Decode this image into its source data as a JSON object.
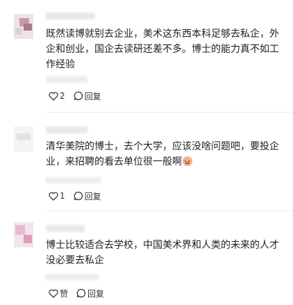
{
  "comments": [
    {
      "text": "既然读博就别去企业，美术这东西本科足够去私企，外企和创业，国企去读研还差不多。博士的能力真不如工作经验",
      "like_count": "2",
      "reply_label": "回复"
    },
    {
      "text": "清华美院的博士，去个大学，应该没啥问题吧，要投企业，来招聘的看去单位很一般啊",
      "like_count": "1",
      "reply_label": "回复"
    },
    {
      "text": "博士比较适合去学校，中国美术界和人类的未来的人才没必要去私企",
      "like_count": "赞",
      "reply_label": "回复"
    }
  ],
  "colors": {
    "text": "#1f1f1f",
    "icon": "#333333",
    "divider": "#ececec"
  }
}
